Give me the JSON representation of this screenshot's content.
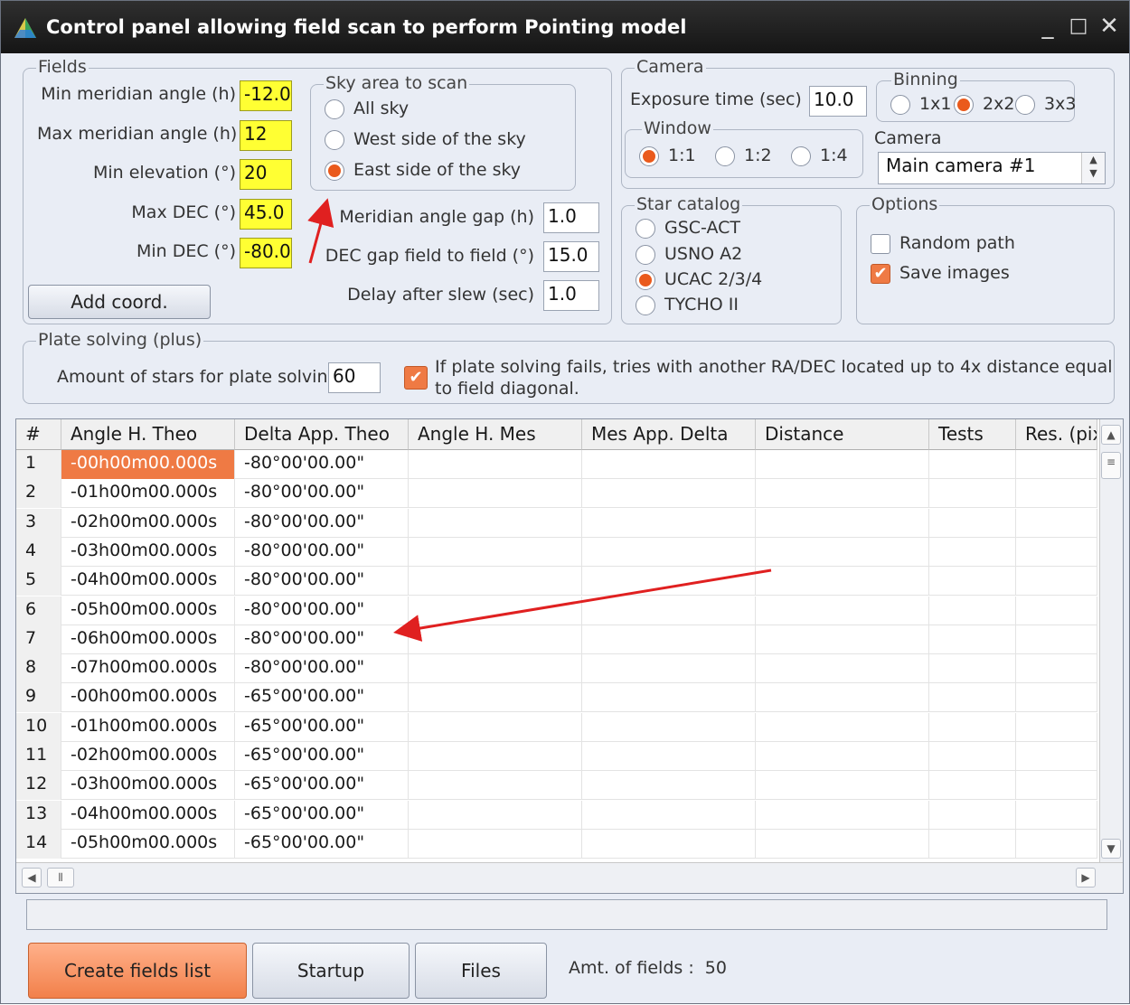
{
  "window": {
    "title": "Control panel allowing field scan to perform Pointing model"
  },
  "fields": {
    "group_label": "Fields",
    "min_meridian_label": "Min meridian angle (h)",
    "min_meridian_value": "-12.0",
    "max_meridian_label": "Max meridian angle (h)",
    "max_meridian_value": "12",
    "min_elevation_label": "Min elevation (°)",
    "min_elevation_value": "20",
    "max_dec_label": "Max DEC (°)",
    "max_dec_value": "45.0",
    "min_dec_label": "Min DEC (°)",
    "min_dec_value": "-80.0",
    "add_coord_label": "Add coord.",
    "meridian_gap_label": "Meridian angle gap (h)",
    "meridian_gap_value": "1.0",
    "dec_gap_label": "DEC gap field to field (°)",
    "dec_gap_value": "15.0",
    "delay_label": "Delay after slew (sec)",
    "delay_value": "1.0"
  },
  "sky_area": {
    "group_label": "Sky area to scan",
    "options": [
      "All sky",
      "West side of the sky",
      "East side of the sky"
    ],
    "selected": "East side of the sky"
  },
  "camera": {
    "group_label": "Camera",
    "exposure_label": "Exposure time (sec)",
    "exposure_value": "10.0",
    "binning_label": "Binning",
    "binning_options": [
      "1x1",
      "2x2",
      "3x3"
    ],
    "binning_selected": "2x2",
    "window_label": "Window",
    "window_options": [
      "1:1",
      "1:2",
      "1:4"
    ],
    "window_selected": "1:1",
    "camera_label": "Camera",
    "camera_selected": "Main camera #1"
  },
  "star_catalog": {
    "group_label": "Star catalog",
    "options": [
      "GSC-ACT",
      "USNO A2",
      "UCAC 2/3/4",
      "TYCHO II"
    ],
    "selected": "UCAC 2/3/4"
  },
  "options": {
    "group_label": "Options",
    "random_path_label": "Random path",
    "random_path_checked": false,
    "save_images_label": "Save images",
    "save_images_checked": true
  },
  "plate_solving": {
    "group_label": "Plate solving (plus)",
    "amount_label": "Amount of stars for plate solving",
    "amount_value": "60",
    "retry_line1": "If plate solving fails, tries with another RA/DEC located up to 4x distance equal",
    "retry_line2": "to field diagonal.",
    "retry_checked": true
  },
  "table": {
    "columns": [
      "#",
      "Angle H. Theo",
      "Delta App. Theo",
      "Angle H. Mes",
      "Mes App. Delta",
      "Distance",
      "Tests",
      "Res. (pix"
    ],
    "rows": [
      [
        "1",
        "-00h00m00.000s",
        "-80°00'00.00\""
      ],
      [
        "2",
        "-01h00m00.000s",
        "-80°00'00.00\""
      ],
      [
        "3",
        "-02h00m00.000s",
        "-80°00'00.00\""
      ],
      [
        "4",
        "-03h00m00.000s",
        "-80°00'00.00\""
      ],
      [
        "5",
        "-04h00m00.000s",
        "-80°00'00.00\""
      ],
      [
        "6",
        "-05h00m00.000s",
        "-80°00'00.00\""
      ],
      [
        "7",
        "-06h00m00.000s",
        "-80°00'00.00\""
      ],
      [
        "8",
        "-07h00m00.000s",
        "-80°00'00.00\""
      ],
      [
        "9",
        "-00h00m00.000s",
        "-65°00'00.00\""
      ],
      [
        "10",
        "-01h00m00.000s",
        "-65°00'00.00\""
      ],
      [
        "11",
        "-02h00m00.000s",
        "-65°00'00.00\""
      ],
      [
        "12",
        "-03h00m00.000s",
        "-65°00'00.00\""
      ],
      [
        "13",
        "-04h00m00.000s",
        "-65°00'00.00\""
      ],
      [
        "14",
        "-05h00m00.000s",
        "-65°00'00.00\""
      ]
    ]
  },
  "footer": {
    "create_label": "Create fields list",
    "startup_label": "Startup",
    "files_label": "Files",
    "amount_text": "Amt. of fields :  50"
  },
  "colors": {
    "highlight": "#ffff33",
    "accent": "#ef7a44",
    "annotation_arrow": "#e02020"
  }
}
